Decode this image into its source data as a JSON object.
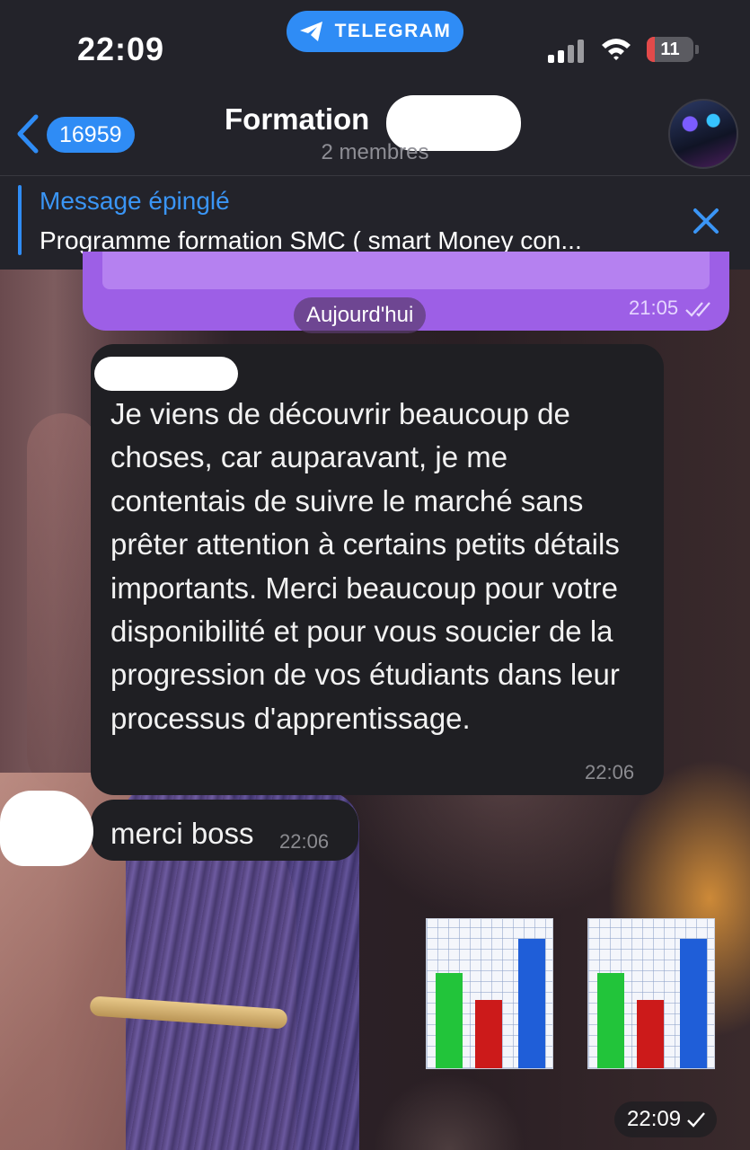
{
  "status_bar": {
    "time": "22:09",
    "app_pill": "TELEGRAM",
    "battery_level": "11"
  },
  "header": {
    "unread_count": "16959",
    "title": "Formation",
    "subtitle": "2 membres"
  },
  "pinned": {
    "label": "Message épinglé",
    "text": "Programme formation SMC ( smart Money con..."
  },
  "previous_message": {
    "time": "21:05",
    "status": "read"
  },
  "date_separator": "Aujourd'hui",
  "messages": [
    {
      "text": "Je viens de découvrir beaucoup de choses, car auparavant, je me contentais de suivre le marché sans prêter attention à certains petits détails importants. Merci beaucoup pour votre disponibilité et pour vous soucier de la progression de vos étudiants dans leur processus d'apprentissage.",
      "time": "22:06"
    },
    {
      "text": "merci boss",
      "time": "22:06"
    }
  ],
  "emoji_message": {
    "emojis": [
      "bar-chart-emoji",
      "bar-chart-emoji"
    ],
    "time": "22:09",
    "status": "sent"
  },
  "colors": {
    "accent": "#2f8cf5",
    "outgoing_bubble": "#9d5fe6",
    "incoming_bubble": "#1f1f23",
    "header_bg": "#23232a"
  }
}
